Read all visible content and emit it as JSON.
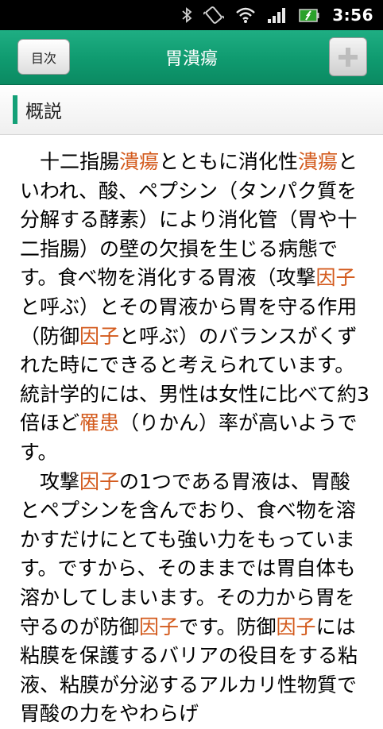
{
  "status_bar": {
    "time": "3:56",
    "icons": [
      "bluetooth-icon",
      "vibrate-icon",
      "wifi-icon",
      "signal-icon",
      "battery-icon"
    ]
  },
  "header": {
    "toc_button_label": "目次",
    "title": "胃潰瘍",
    "add_button_icon": "plus-icon"
  },
  "section": {
    "title": "概説"
  },
  "article": {
    "highlight_color": "#d35a1c",
    "paragraphs": [
      [
        {
          "t": "十二指腸"
        },
        {
          "t": "潰瘍",
          "h": true
        },
        {
          "t": "とともに消化性"
        },
        {
          "t": "潰瘍",
          "h": true
        },
        {
          "t": "といわれ、酸、ペプシン（タンパク質を分解する酵素）により消化管（胃や十二指腸）の壁の欠損を生じる病態です。食べ物を消化する胃液（攻撃"
        },
        {
          "t": "因子",
          "h": true
        },
        {
          "t": "と呼ぶ）とその胃液から胃を守る作用（防御"
        },
        {
          "t": "因子",
          "h": true
        },
        {
          "t": "と呼ぶ）のバランスがくずれた時にできると考えられています。統計学的には、男性は女性に比べて約3倍ほど"
        },
        {
          "t": "罹患",
          "h": true
        },
        {
          "t": "（りかん）率が高いようです。"
        }
      ],
      [
        {
          "t": "攻撃"
        },
        {
          "t": "因子",
          "h": true
        },
        {
          "t": "の1つである胃液は、胃酸とペプシンを含んでおり、食べ物を溶かすだけにとても強い力をもっています。ですから、そのままでは胃自体も溶かしてしまいます。その力から胃を守るのが防御"
        },
        {
          "t": "因子",
          "h": true
        },
        {
          "t": "です。防御"
        },
        {
          "t": "因子",
          "h": true
        },
        {
          "t": "には粘膜を保護するバリアの役目をする粘液、粘膜が分泌するアルカリ性物質で胃酸の力をやわらげ"
        }
      ]
    ]
  }
}
